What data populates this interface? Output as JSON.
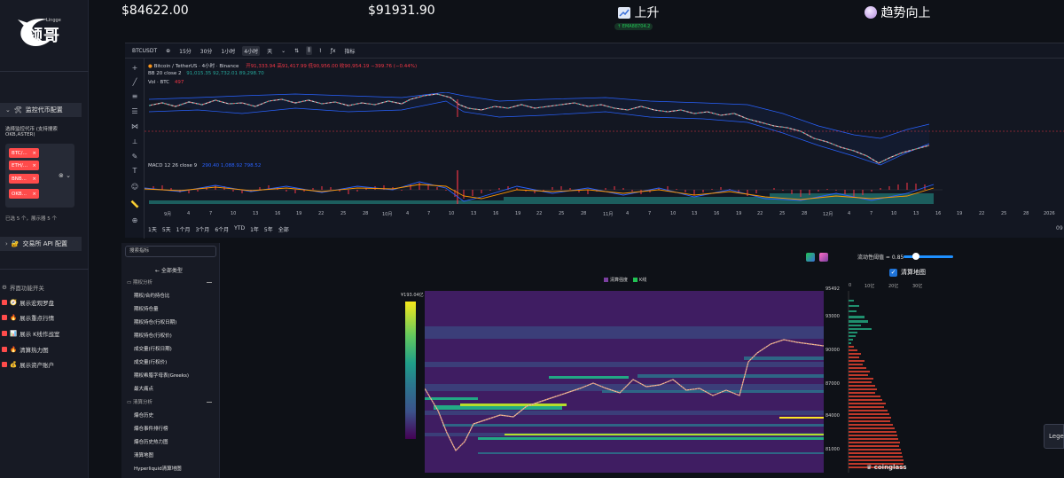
{
  "sidebar": {
    "logo_text": "领哥",
    "logo_small": "Lingge",
    "monitor_section": {
      "title": "监控代币配置",
      "label": "选择监控代币 (支持搜索",
      "sublabel": "OKB,ASTER)",
      "chips": [
        "BTC/...",
        "ETH/...",
        "BNB...",
        "OKB..."
      ],
      "status": "已选 5 个，展示器 5 个"
    },
    "exchange_section": {
      "title": "交易所 API 配置"
    },
    "toggles_title": "界面功能开关",
    "toggles": [
      "展示宏观罗盘",
      "展示重点行情",
      "展示 K线作战室",
      "清算热力图",
      "展示资产账户"
    ]
  },
  "top": {
    "price_1": "$84622.00",
    "price_2": "$91931.90",
    "trend_label": "上升",
    "ema_badge": "↑ EMA88704.2",
    "trend_2": "趋势向上"
  },
  "tv": {
    "symbol": "BTCUSDT",
    "intervals": [
      "15分",
      "30分",
      "1小时",
      "4小时",
      "天"
    ],
    "active_interval": "4小时",
    "indicators_label": "指标",
    "legend_title": "Bitcoin / TetherUS · 4小时 · Binance",
    "ohlc": "开91,333.94 高91,417.99 低90,956.00 收90,954.19 −399.76 (−0.44%)",
    "bb_label": "BB 20 close 2",
    "bb_values": "91,015.35  92,732.01  89,298.70",
    "vol_label": "Vol · BTC",
    "vol_value": "497",
    "macd_label": "MACD 12 26 close 9",
    "macd_values": "290.40   1,088.92   798.52",
    "date_axis": [
      "9月",
      "4",
      "7",
      "10",
      "13",
      "16",
      "19",
      "22",
      "25",
      "28",
      "10月",
      "4",
      "7",
      "10",
      "13",
      "16",
      "19",
      "22",
      "25",
      "28",
      "11月",
      "4",
      "7",
      "10",
      "13",
      "16",
      "19",
      "22",
      "25",
      "28",
      "12月",
      "4",
      "7",
      "10",
      "13",
      "16",
      "19",
      "22",
      "25",
      "28",
      "2026"
    ],
    "ranges": [
      "1天",
      "5天",
      "1个月",
      "3个月",
      "6个月",
      "YTD",
      "1年",
      "5年",
      "全部"
    ],
    "right_tick": "09"
  },
  "filter": {
    "search_placeholder": "搜索指标",
    "all_label": "← 全部类型",
    "group_1": "期权分析",
    "items_1": [
      "期权/合约持仓比",
      "期权持仓量",
      "期权持仓(行权日期)",
      "期权持仓(行权价)",
      "成交量(行权日期)",
      "成交量(行权价)",
      "期权希腊字母表(Greeks)",
      "最大痛点"
    ],
    "group_2": "清算分析",
    "items_2": [
      "爆仓历史",
      "爆仓事件排行榜",
      "爆仓历史热力图",
      "清算地图",
      "Hyperliquid清算地图"
    ]
  },
  "heatmap": {
    "threshold_label": "流动性阈值 = 0.85",
    "threshold_value": 0.85,
    "check_label": "清算地图",
    "legend": [
      "清算强度",
      "K线"
    ],
    "legend_colors": [
      "#7b3fa0",
      "#21c354"
    ],
    "cbar_label": "¥193.04亿",
    "price_axis": [
      "95492",
      "93000",
      "90000",
      "87000",
      "84000",
      "81000"
    ],
    "depth_axis": [
      "0",
      "10亿",
      "20亿",
      "30亿"
    ],
    "watermark": "coinglass",
    "legend_tab": "Lege"
  },
  "colors": {
    "accent": "#ff4b4b",
    "up": "#21c354",
    "bg": "#0e1117"
  }
}
